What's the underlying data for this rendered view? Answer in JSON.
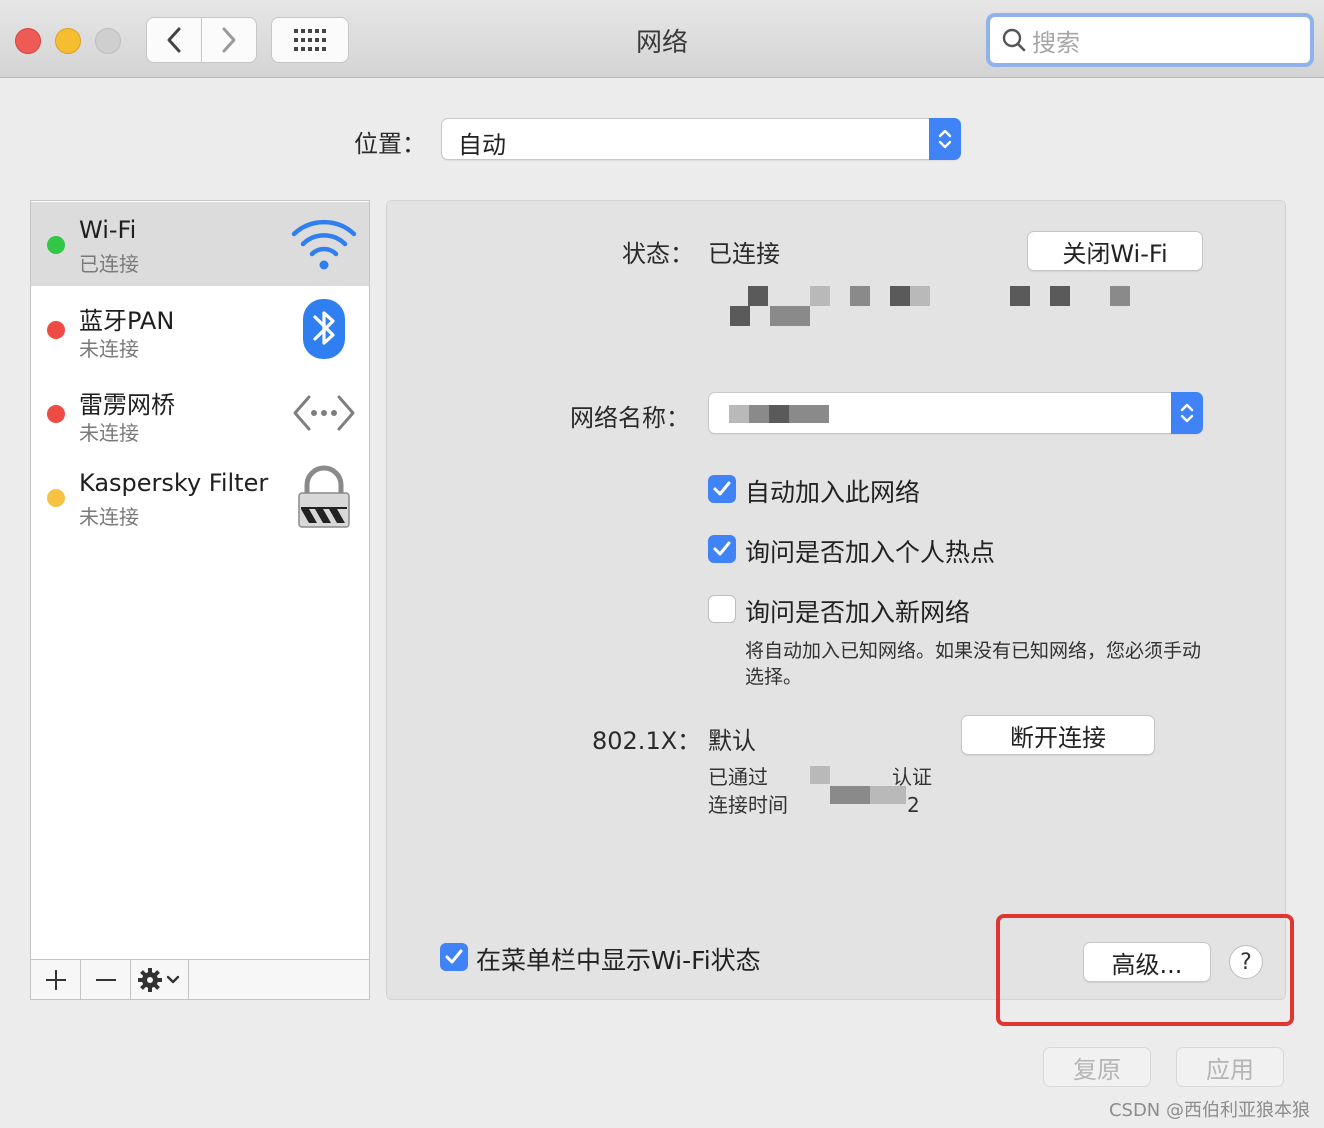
{
  "window": {
    "title": "网络"
  },
  "toolbar": {
    "search_placeholder": "搜索"
  },
  "location": {
    "label": "位置：",
    "value": "自动"
  },
  "services": [
    {
      "name": "Wi-Fi",
      "status": "已连接",
      "dot_color": "#33c748",
      "icon": "wifi-icon"
    },
    {
      "name": "蓝牙PAN",
      "status": "未连接",
      "dot_color": "#ee4b44",
      "icon": "bluetooth-icon"
    },
    {
      "name": "雷雳网桥",
      "status": "未连接",
      "dot_color": "#ee4b44",
      "icon": "thunderbolt-bridge-icon"
    },
    {
      "name": "Kaspersky Filter",
      "status": "未连接",
      "dot_color": "#f5c242",
      "icon": "lock-icon"
    }
  ],
  "detail": {
    "status_label": "状态：",
    "status_value": "已连接",
    "turn_off_button": "关闭Wi-Fi",
    "network_name_label": "网络名称：",
    "checkboxes": [
      {
        "label": "自动加入此网络",
        "checked": true
      },
      {
        "label": "询问是否加入个人热点",
        "checked": true
      },
      {
        "label": "询问是否加入新网络",
        "checked": false
      }
    ],
    "note": "将自动加入已知网络。如果没有已知网络，您必须手动选择。",
    "dot1x_label": "802.1X：",
    "dot1x_value": "默认",
    "disconnect_button": "断开连接",
    "auth_line1": "已通过",
    "auth_line1_tail": "认证",
    "auth_line2": "连接时间",
    "auth_line2_tail": "2",
    "menubar_checkbox": {
      "label": "在菜单栏中显示Wi-Fi状态",
      "checked": true
    },
    "advanced_button": "高级...",
    "help_button": "?"
  },
  "footer": {
    "revert_button": "复原",
    "apply_button": "应用"
  },
  "watermark": "CSDN @西伯利亚狼本狼",
  "colors": {
    "accent": "#3f83f6",
    "highlight": "#e0362f"
  }
}
